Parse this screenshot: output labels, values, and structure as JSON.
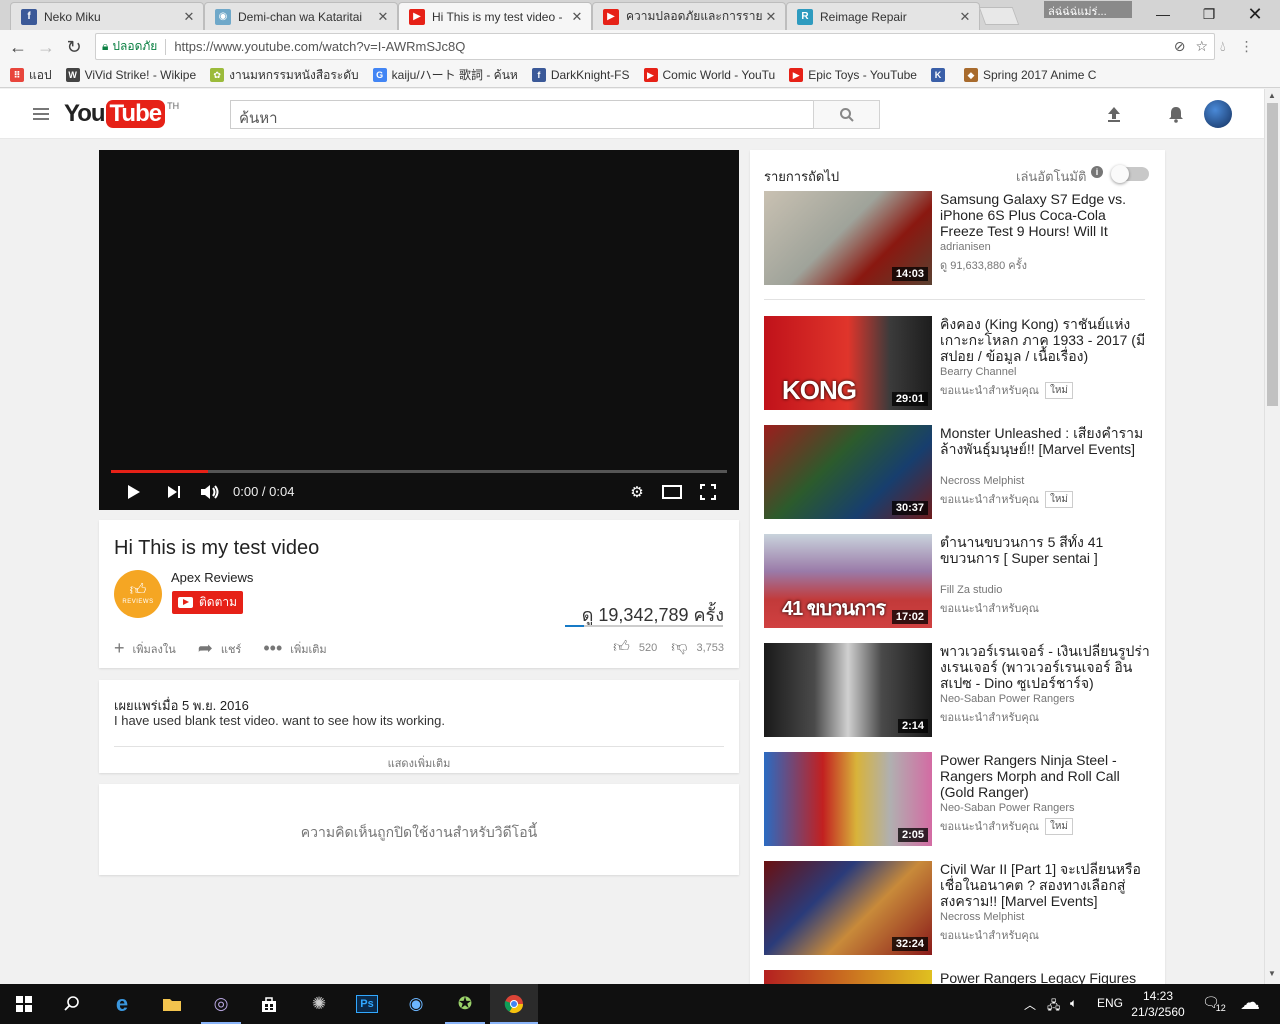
{
  "browser": {
    "tabs": [
      {
        "title": "Neko Miku",
        "color": "#3b5998",
        "glyph": "f"
      },
      {
        "title": "Demi-chan wa Kataritai",
        "color": "#6fa8c9",
        "glyph": "◉"
      },
      {
        "title": "Hi This is my test video -",
        "color": "#e62117",
        "glyph": "▶"
      },
      {
        "title": "ความปลอดภัยและการรายงาน",
        "color": "#e62117",
        "glyph": "▶"
      },
      {
        "title": "Reimage Repair",
        "color": "#2e9bbf",
        "glyph": "R"
      }
    ],
    "profile_name": "ล่ฉ่ฉ่ฉ่แม่ร่...",
    "secure_label": "ปลอดภัย",
    "url": "https://www.youtube.com/watch?v=I-AWRmSJc8Q",
    "bookmarks": [
      {
        "label": "แอป",
        "color": "#e8453c",
        "glyph": "⠿"
      },
      {
        "label": "ViVid Strike! - Wikipe",
        "color": "#444",
        "glyph": "W"
      },
      {
        "label": "งานมหกรรมหนังสือระดับ",
        "color": "#9bbb3b",
        "glyph": "✿"
      },
      {
        "label": "kaiju/ハート 歌詞 - ค้นห",
        "color": "#4285f4",
        "glyph": "G"
      },
      {
        "label": "DarkKnight-FS",
        "color": "#3b5998",
        "glyph": "f"
      },
      {
        "label": "Comic World - YouTu",
        "color": "#e62117",
        "glyph": "▶"
      },
      {
        "label": "Epic Toys - YouTube",
        "color": "#e62117",
        "glyph": "▶"
      },
      {
        "label": "",
        "color": "#3a5fa8",
        "glyph": "K"
      },
      {
        "label": "Spring 2017 Anime C",
        "color": "#a86b2d",
        "glyph": "◆"
      }
    ]
  },
  "youtube": {
    "logo_you": "You",
    "logo_tube": "Tube",
    "logo_country": "TH",
    "search_placeholder": "ค้นหา"
  },
  "player": {
    "time": "0:00 / 0:04",
    "progress_fraction": 0.157
  },
  "video": {
    "title": "Hi This is my test video",
    "channel": "Apex Reviews",
    "channel_avatar_text": "REVIEWS",
    "subscribe_label": "ติดตาม",
    "views": "ดู 19,342,789 ครั้ง",
    "like_fraction": 0.122,
    "actions": {
      "add": "เพิ่มลงใน",
      "share": "แชร์",
      "more": "เพิ่มเติม"
    },
    "likes": "520",
    "dislikes": "3,753",
    "published": "เผยแพร่เมื่อ 5 พ.ย. 2016",
    "description": "I have used blank test video. want to see how its working.",
    "show_more": "แสดงเพิ่มเติม",
    "comments_disabled": "ความคิดเห็นถูกปิดใช้งานสำหรับวิดีโอนี้"
  },
  "sidebar": {
    "up_next": "รายการถัดไป",
    "autoplay": "เล่นอัตโนมัติ",
    "items": [
      {
        "title": "Samsung Galaxy S7 Edge vs. iPhone 6S Plus Coca-Cola Freeze Test 9 Hours! Will It Survive ?",
        "channel": "adrianisen",
        "meta": "ดู 91,633,880 ครั้ง",
        "badge": "",
        "duration": "14:03",
        "overlay": "",
        "bg": "linear-gradient(135deg,#c9c1b2 0%,#9fa39a 45%,#8a1810 70%,#5a4030 100%)"
      },
      {
        "title": "คิงคอง (King Kong) ราชันย์แห่งเกาะกะโหลก ภาค 1933 - 2017 (มีสปอย / ข้อมูล / เนื้อเรื่อง)",
        "channel": "Bearry Channel",
        "meta": "ขอแนะนำสำหรับคุณ",
        "badge": "ใหม่",
        "duration": "29:01",
        "overlay": "KONG",
        "bg": "linear-gradient(90deg,#c0121a 0%,#e0352b 50%,#3b3b3b 75%,#1d1d1d 100%)"
      },
      {
        "title": "Monster Unleashed : เสียงคำราม ล้างพันธุ์มนุษย์!! [Marvel Events]",
        "channel": "Necross Melphist",
        "meta": "ขอแนะนำสำหรับคุณ",
        "badge": "ใหม่",
        "duration": "30:37",
        "overlay": "",
        "bg": "linear-gradient(135deg,#9c1d1d 0%,#2c5b2c 40%,#173e6e 70%,#6d1b1b 100%)"
      },
      {
        "title": "ตำนานขบวนการ 5 สีทั้ง 41 ขบวนการ [ Super sentai ]",
        "channel": "Fill Za studio",
        "meta": "ขอแนะนำสำหรับคุณ",
        "badge": "",
        "duration": "17:02",
        "overlay": "41 ขบวนการ",
        "bg": "linear-gradient(180deg,#c9d3dc 0%,#9a7aa8 40%,#c23a3a 70%,#d04040 100%)"
      },
      {
        "title": "พาวเวอร์เรนเจอร์ - เงินเปลี่ยนรูปร่างเรนเจอร์ (พาวเวอร์เรนเจอร์ อินสเปซ - Dino ซูเปอร์ชาร์จ)",
        "channel": "Neo-Saban Power Rangers",
        "meta": "ขอแนะนำสำหรับคุณ",
        "badge": "",
        "duration": "2:14",
        "overlay": "",
        "bg": "linear-gradient(90deg,#1a1a1a 0%,#4a4a4a 30%,#d0d0d0 50%,#4a4a4a 70%,#1a1a1a 100%)"
      },
      {
        "title": "Power Rangers Ninja Steel - Rangers Morph and Roll Call (Gold Ranger)",
        "channel": "Neo-Saban Power Rangers",
        "meta": "ขอแนะนำสำหรับคุณ",
        "badge": "ใหม่",
        "duration": "2:05",
        "overlay": "",
        "bg": "linear-gradient(90deg,#2b6bc2 0%,#c22020 35%,#d8b33a 55%,#b0b0b0 75%,#d36ba3 100%)"
      },
      {
        "title": "Civil War II [Part 1] จะเปลี่ยนหรือเชื่อในอนาคต ? สองทางเลือกสู่สงคราม!! [Marvel Events]",
        "channel": "Necross Melphist",
        "meta": "ขอแนะนำสำหรับคุณ",
        "badge": "",
        "duration": "32:24",
        "overlay": "",
        "bg": "linear-gradient(135deg,#6a1010 0%,#2a3b7a 35%,#c88a3a 60%,#8a1a1a 100%)"
      },
      {
        "title": "Power Rangers Legacy Figures",
        "channel": "",
        "meta": "",
        "badge": "",
        "duration": "",
        "overlay": "",
        "bg": "linear-gradient(90deg,#b42020 0%,#e0c020 100%)"
      }
    ]
  },
  "taskbar": {
    "lang": "ENG",
    "time": "14:23",
    "date": "21/3/2560",
    "notifications": "12"
  }
}
